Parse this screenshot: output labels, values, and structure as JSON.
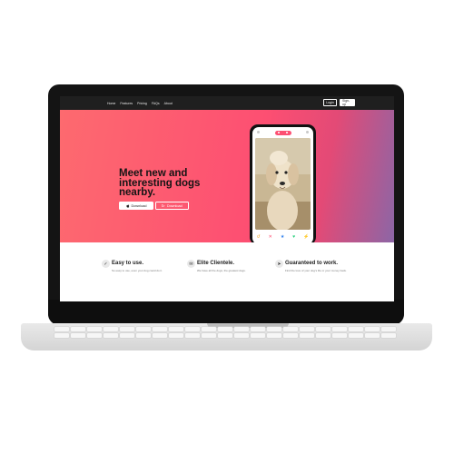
{
  "nav": {
    "links": [
      "Home",
      "Features",
      "Pricing",
      "FAQs",
      "About"
    ],
    "login": "Login",
    "signup": "Sign-up"
  },
  "hero": {
    "headline": "Meet new and interesting dogs nearby.",
    "download_apple": "Download",
    "download_android": "Download",
    "colors": {
      "start": "#fd6a6f",
      "end": "#8c66a6"
    }
  },
  "phone": {
    "icons": [
      "profile-icon",
      "paw-icon",
      "chat-icon"
    ],
    "actions": [
      "undo-icon",
      "dislike-icon",
      "star-icon",
      "like-icon",
      "boost-icon"
    ]
  },
  "features": [
    {
      "icon": "check-icon",
      "title": "Easy to use.",
      "text": "So easy to use, even your dog could do it."
    },
    {
      "icon": "chat-icon",
      "title": "Elite Clientele.",
      "text": "We have all the dogs, the greatest dogs."
    },
    {
      "icon": "rocket-icon",
      "title": "Guaranteed to work.",
      "text": "Find the love of your dog's life or your money back."
    }
  ]
}
